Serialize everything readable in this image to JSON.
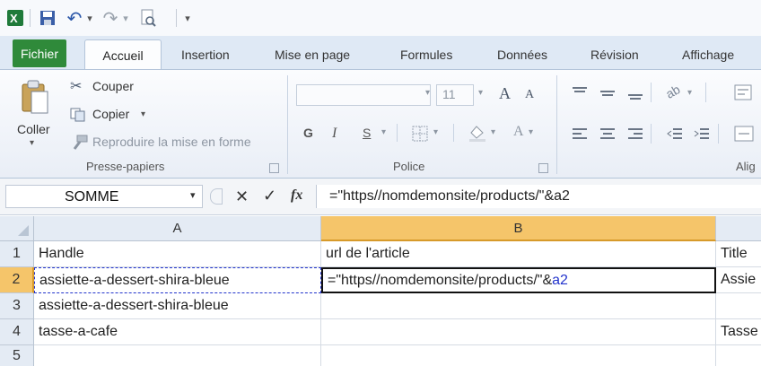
{
  "qat": {
    "undo_glyph": "↶",
    "redo_glyph": "↷",
    "caret": "▾"
  },
  "tabs": [
    "Fichier",
    "Accueil",
    "Insertion",
    "Mise en page",
    "Formules",
    "Données",
    "Révision",
    "Affichage"
  ],
  "ribbon": {
    "clipboard": {
      "paste": "Coller",
      "cut": "Couper",
      "copy": "Copier",
      "copy_caret": "▾",
      "format_painter": "Reproduire la mise en forme",
      "group": "Presse-papiers"
    },
    "font": {
      "size": "11",
      "bold": "G",
      "italic": "I",
      "underline": "S",
      "grow": "A",
      "shrink": "A",
      "group": "Police"
    },
    "alignment": {
      "group": "Alig"
    }
  },
  "formula_bar": {
    "name_box": "SOMME",
    "fx": "fx",
    "cancel": "✕",
    "enter": "✓",
    "formula": "=\"https//nomdemonsite/products/\"&a2"
  },
  "grid": {
    "columns": [
      "A",
      "B"
    ],
    "rows": [
      "1",
      "2",
      "3",
      "4",
      "5"
    ],
    "cells": {
      "A1": "Handle",
      "B1": "url de l'article",
      "C1": "Title",
      "A2": "assiette-a-dessert-shira-bleue",
      "B2_prefix": "=\"https//nomdemonsite/products/\"&",
      "B2_ref": "a2",
      "C2": "Assie",
      "A3": "assiette-a-dessert-shira-bleue",
      "A4": "tasse-a-cafe",
      "C4": "Tasse"
    }
  },
  "colors": {
    "file_tab": "#2f8a3a",
    "selected_col": "#f5c56a",
    "ref_blue": "#2233cc",
    "ref_border": "#2233cc"
  }
}
